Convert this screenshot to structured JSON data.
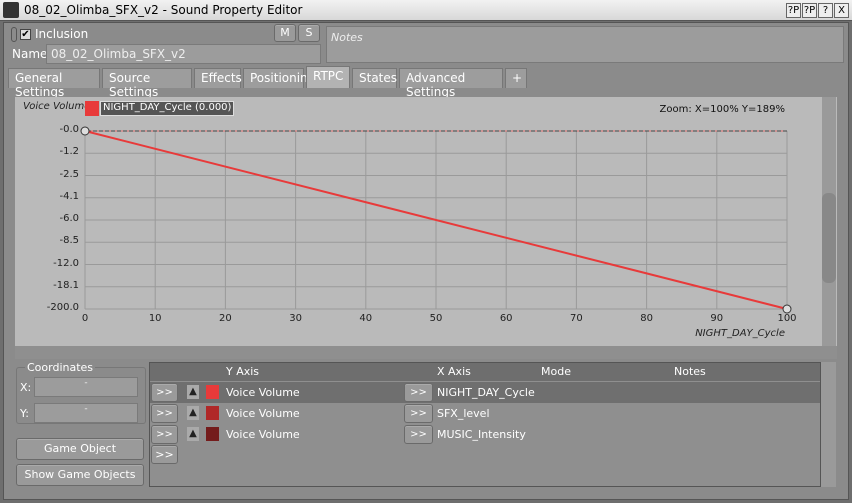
{
  "window": {
    "title": "08_02_Olimba_SFX_v2 - Sound Property Editor",
    "buttons": [
      "?P",
      "?P",
      "?",
      "X"
    ]
  },
  "header": {
    "inclusion_label": "Inclusion",
    "inclusion_checked": true,
    "mute_label": "M",
    "solo_label": "S",
    "name_label": "Name",
    "name_value": "08_02_Olimba_SFX_v2",
    "notes_placeholder": "Notes"
  },
  "tabs": [
    {
      "label": "General Settings"
    },
    {
      "label": "Source Settings"
    },
    {
      "label": "Effects"
    },
    {
      "label": "Positioning"
    },
    {
      "label": "RTPC",
      "active": true
    },
    {
      "label": "States"
    },
    {
      "label": "Advanced Settings"
    },
    {
      "label": "+"
    }
  ],
  "graph": {
    "y_title": "Voice Volume",
    "curve_label": "NIGHT_DAY_Cycle (0.000)",
    "curve_color": "#e83a3a",
    "zoom_text": "Zoom: X=100% Y=189%",
    "x_title": "NIGHT_DAY_Cycle",
    "y_ticks": [
      "-0.0",
      "-1.2",
      "-2.5",
      "-4.1",
      "-6.0",
      "-8.5",
      "-12.0",
      "-18.1",
      "-200.0"
    ],
    "x_ticks": [
      "0",
      "10",
      "20",
      "30",
      "40",
      "50",
      "60",
      "70",
      "80",
      "90",
      "100"
    ],
    "points": [
      {
        "x": 0,
        "y": "-0.0"
      },
      {
        "x": 100,
        "y": "-200.0"
      }
    ]
  },
  "coordinates": {
    "title": "Coordinates",
    "x_label": "X:",
    "x_value": "-",
    "y_label": "Y:",
    "y_value": "-"
  },
  "buttons": {
    "explorer": "Game Object Explorer...",
    "show": "Show Game Objects",
    "expand": ">>"
  },
  "table": {
    "headers": {
      "y": "Y Axis",
      "x": "X Axis",
      "mode": "Mode",
      "notes": "Notes"
    },
    "rows": [
      {
        "y": "Voice Volume",
        "x": "NIGHT_DAY_Cycle",
        "color": "#e83a3a",
        "selected": true
      },
      {
        "y": "Voice Volume",
        "x": "SFX_level",
        "color": "#b02828"
      },
      {
        "y": "Voice Volume",
        "x": "MUSIC_Intensity",
        "color": "#741c1c"
      }
    ]
  }
}
